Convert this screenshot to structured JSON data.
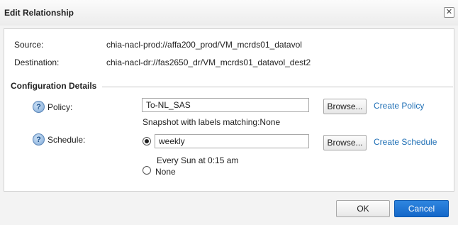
{
  "dialog": {
    "title": "Edit Relationship",
    "close_glyph": "✕"
  },
  "info": {
    "source_label": "Source:",
    "source_value": "chia-nacl-prod://affa200_prod/VM_mcrds01_datavol",
    "destination_label": "Destination:",
    "destination_value": "chia-nacl-dr://fas2650_dr/VM_mcrds01_datavol_dest2"
  },
  "config": {
    "section_title": "Configuration Details",
    "help_glyph": "?",
    "policy": {
      "label": "Policy:",
      "value": "To-NL_SAS",
      "browse_label": "Browse...",
      "create_label": "Create Policy",
      "note": "Snapshot with labels matching:None"
    },
    "schedule": {
      "label": "Schedule:",
      "value": "weekly",
      "browse_label": "Browse...",
      "create_label": "Create Schedule",
      "note": "Every Sun at 0:15 am",
      "none_label": "None",
      "selected_option": "weekly"
    }
  },
  "footer": {
    "ok_label": "OK",
    "cancel_label": "Cancel"
  },
  "colors": {
    "link": "#1f6fb5",
    "primary_button": "#1467c8"
  },
  "icons": {
    "close": "close-icon",
    "help": "help-icon"
  }
}
